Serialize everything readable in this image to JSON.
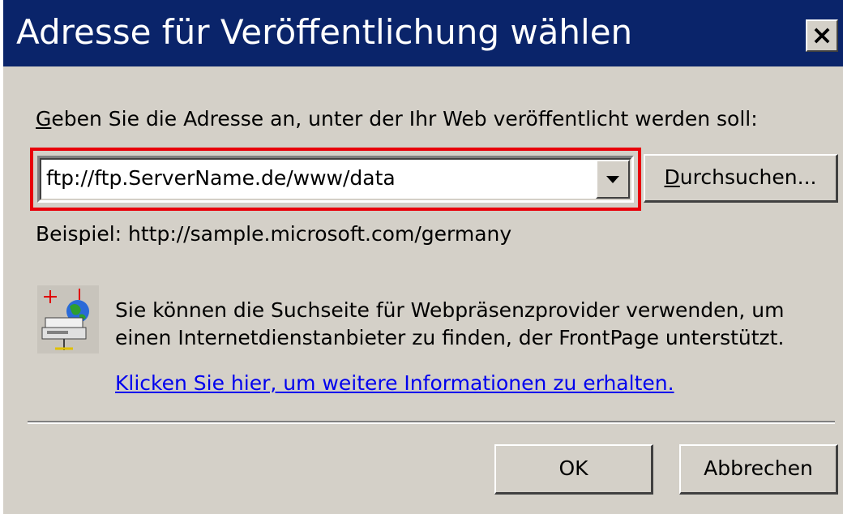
{
  "dialog": {
    "title": "Adresse für Veröffentlichung wählen",
    "close_label": "×"
  },
  "prompt": {
    "accel": "G",
    "rest": "eben Sie die Adresse an, unter der Ihr Web veröffentlicht werden soll:"
  },
  "address_combo": {
    "value": "ftp://ftp.ServerName.de/www/data"
  },
  "browse_button": {
    "accel": "D",
    "rest": "urchsuchen..."
  },
  "example_text": "Beispiel: http://sample.microsoft.com/germany",
  "info": {
    "line1": "Sie können die Suchseite für Webpräsenzprovider verwenden, um",
    "line2": "einen Internetdienstanbieter zu finden, der FrontPage unterstützt.",
    "icon": "globe-server-icon"
  },
  "link_text": "Klicken Sie hier, um weitere Informationen zu erhalten.",
  "buttons": {
    "ok": "OK",
    "cancel": "Abbrechen"
  },
  "colors": {
    "titlebar": "#0a246a",
    "dialog_bg": "#d4d0c8",
    "highlight": "#e8000a",
    "link": "#0000ee"
  }
}
